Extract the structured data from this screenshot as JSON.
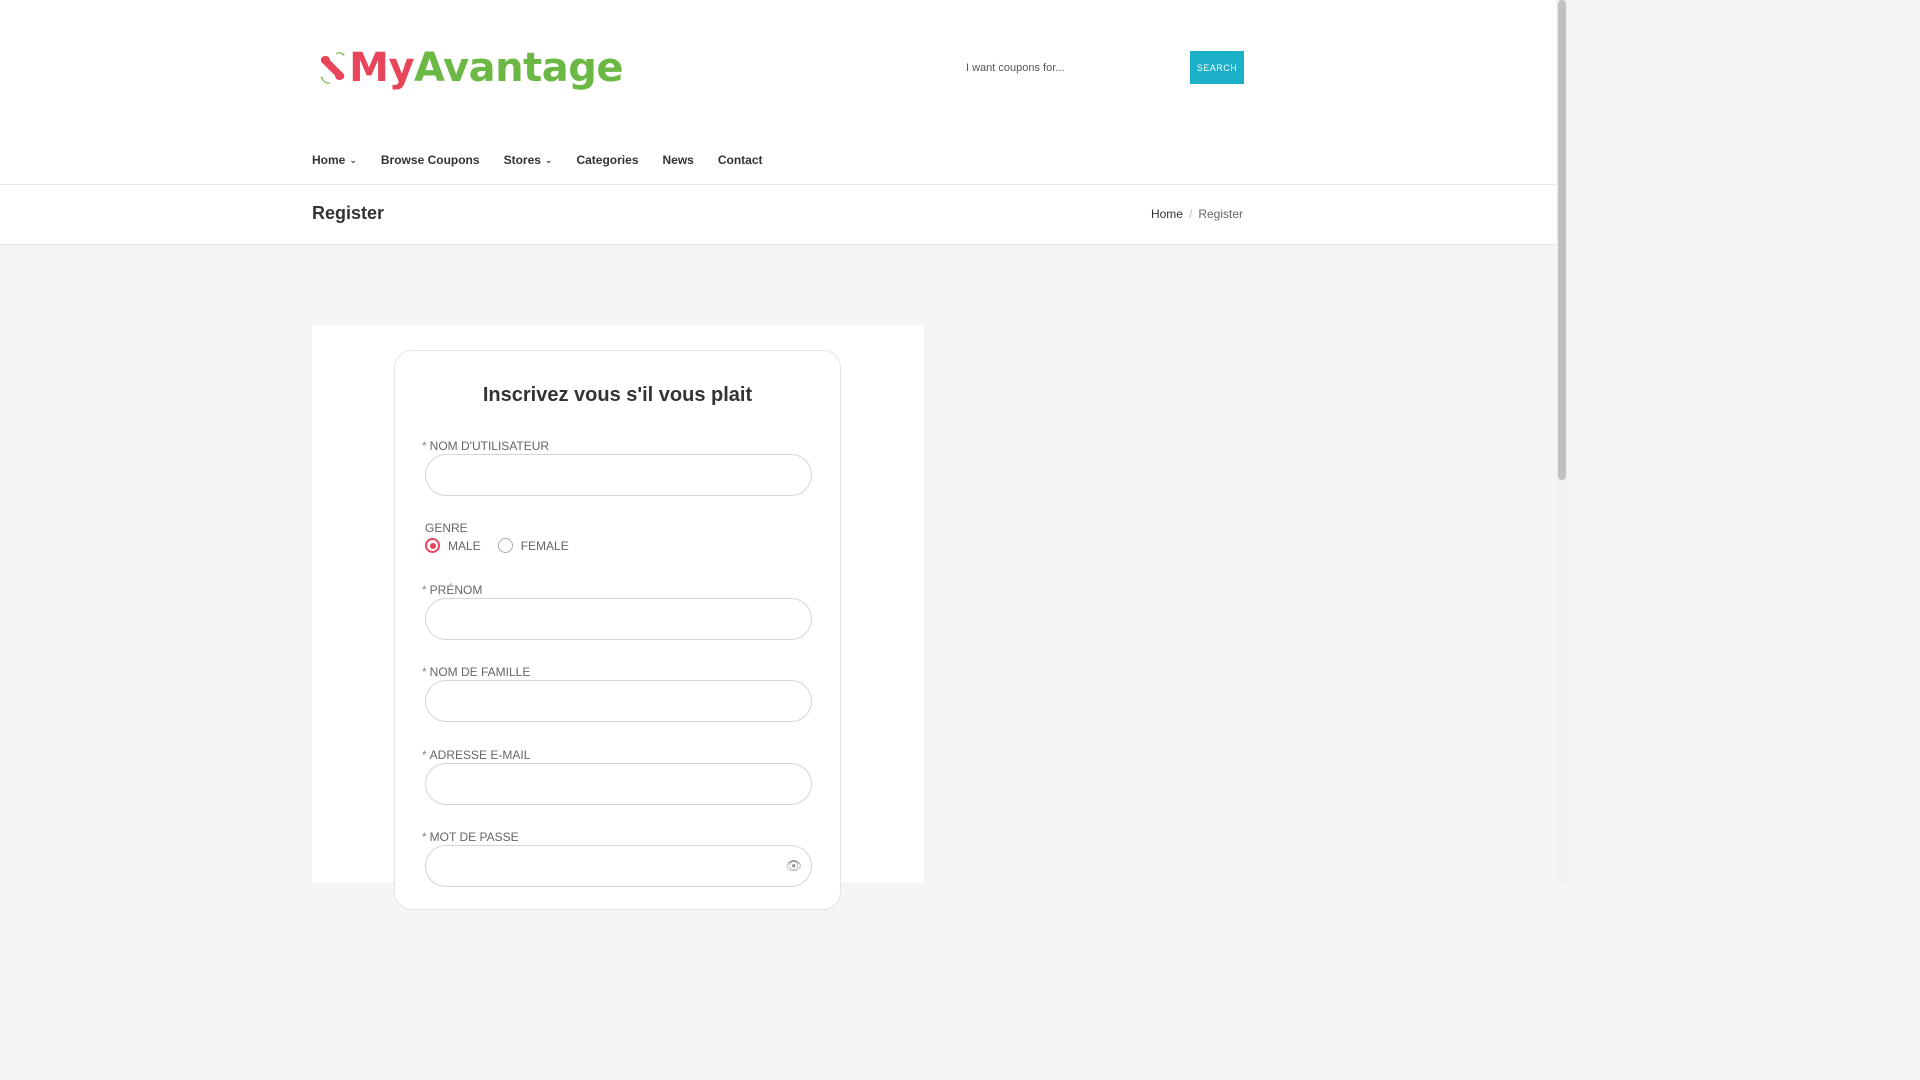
{
  "brand": {
    "name_part1": "My",
    "name_part2": "Avantage"
  },
  "search": {
    "placeholder": "I want coupons for...",
    "button_label": "SEARCH"
  },
  "nav": [
    {
      "label": "Home",
      "has_dropdown": true
    },
    {
      "label": "Browse Coupons",
      "has_dropdown": false
    },
    {
      "label": "Stores",
      "has_dropdown": true
    },
    {
      "label": "Categories",
      "has_dropdown": false
    },
    {
      "label": "News",
      "has_dropdown": false
    },
    {
      "label": "Contact",
      "has_dropdown": false
    }
  ],
  "page": {
    "title": "Register"
  },
  "breadcrumb": {
    "home": "Home",
    "current": "Register"
  },
  "form": {
    "title": "Inscrivez vous s'il vous plait",
    "required_mark": "*",
    "username_label": "NOM D'UTILISATEUR",
    "genre_label": "GENRE",
    "genre_options": [
      {
        "label": "MALE",
        "selected": true
      },
      {
        "label": "FEMALE",
        "selected": false
      }
    ],
    "firstname_label": "PRÉNOM",
    "lastname_label": "NOM DE FAMILLE",
    "email_label": "ADRESSE E-MAIL",
    "password_label": "MOT DE PASSE"
  },
  "colors": {
    "accent_pink": "#e8445a",
    "accent_green": "#6cb844",
    "search_button": "#1ab0c8"
  },
  "icons": {
    "chevron": "chevron-down-icon",
    "password_toggle": "eye-icon"
  }
}
